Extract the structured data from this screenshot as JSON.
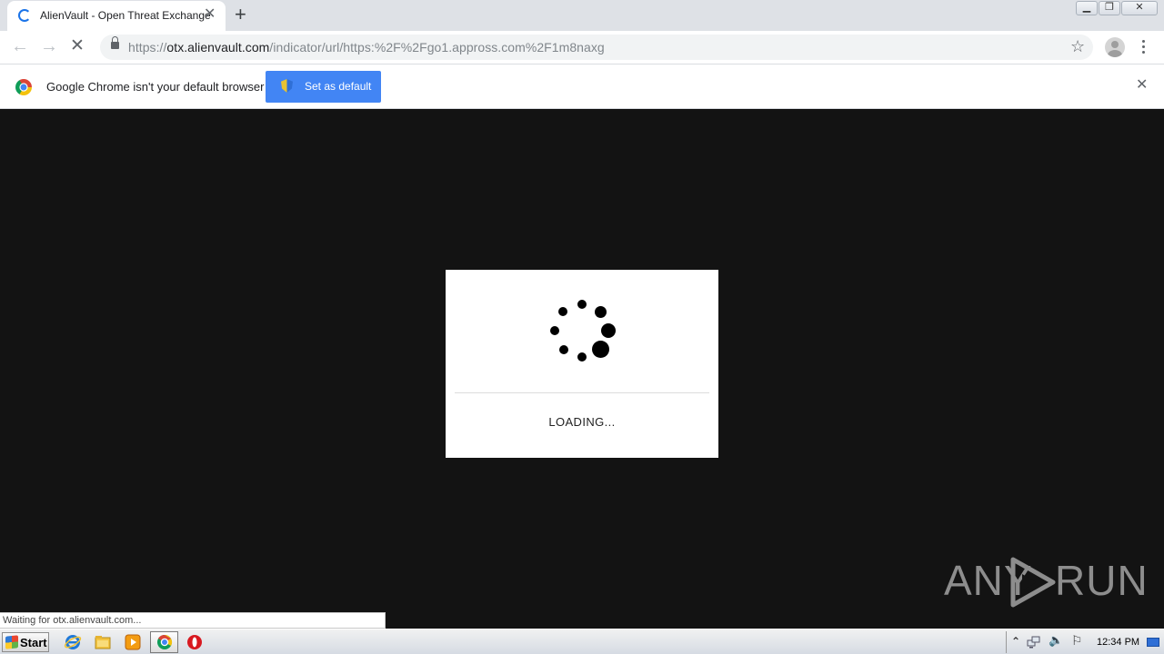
{
  "browser": {
    "tab": {
      "title": "AlienVault - Open Threat Exchange",
      "close_glyph": "✕"
    },
    "new_tab_glyph": "+",
    "window_controls": {
      "minimize": "▁",
      "restore": "❐",
      "close": "✕"
    },
    "nav": {
      "back_glyph": "←",
      "forward_glyph": "→",
      "stop_glyph": "✕"
    },
    "address": {
      "scheme": "https://",
      "host": "otx.alienvault.com",
      "path": "/indicator/url/https:%2F%2Fgo1.appross.com%2F1m8naxg"
    },
    "bookmark_glyph": "☆"
  },
  "infobar": {
    "message": "Google Chrome isn't your default browser",
    "button_label": "Set as default",
    "close_glyph": "✕"
  },
  "page": {
    "loading_text": "LOADING...",
    "status_text": "Waiting for otx.alienvault.com..."
  },
  "watermark": {
    "left": "ANY",
    "right": "RUN"
  },
  "taskbar": {
    "start_label": "Start",
    "clock": "12:34 PM",
    "tray": {
      "expand_glyph": "⌃",
      "volume_glyph": "🔈",
      "flag_glyph": "⚐"
    }
  },
  "colors": {
    "accent": "#4285f4",
    "page_background": "#131313",
    "tab_strip": "#dee1e6",
    "spinner": "#1a73e8"
  },
  "icons": [
    "loading-spinner-icon",
    "back-arrow-icon",
    "forward-arrow-icon",
    "stop-icon",
    "lock-icon",
    "star-icon",
    "profile-icon",
    "menu-icon",
    "chrome-logo-icon",
    "shield-icon",
    "close-icon",
    "internet-explorer-icon",
    "file-explorer-icon",
    "media-player-icon",
    "chrome-icon",
    "opera-icon"
  ]
}
